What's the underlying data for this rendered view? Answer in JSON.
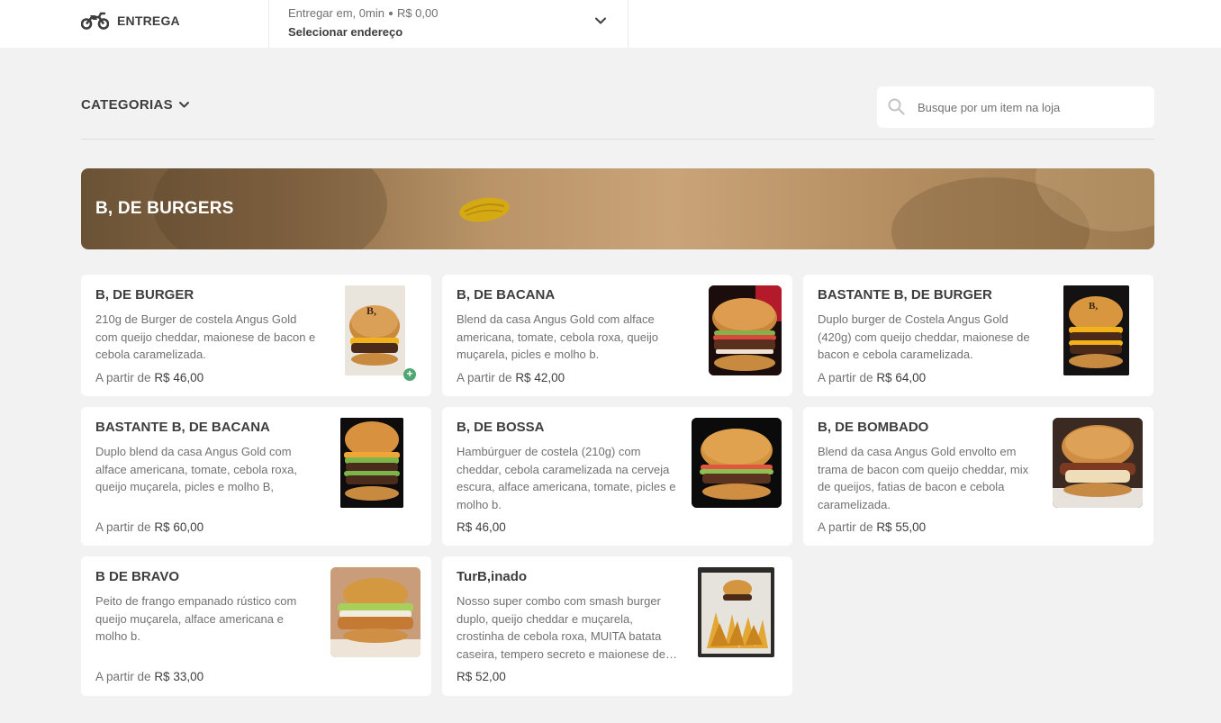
{
  "header": {
    "delivery_mode": "ENTREGA",
    "delivery_icon": "motorcycle-icon",
    "address_line1_time": "Entregar em, 0min",
    "address_line1_fee": "R$ 0,00",
    "address_line2": "Selecionar endereço"
  },
  "toolbar": {
    "categories_label": "CATEGORIAS",
    "search_placeholder": "Busque por um item na loja"
  },
  "section": {
    "title": "B, DE BURGERS"
  },
  "colors": {
    "accent": "#3e3e3e",
    "muted": "#717171",
    "add_badge": "#50a773",
    "page_bg": "#f2f2f2"
  },
  "items": [
    {
      "name": "B, DE BURGER",
      "description": "210g de Burger de costela Angus Gold com queijo cheddar, maionese de bacon e cebola caramelizada.",
      "price_prefix": "A partir de",
      "price": "R$ 46,00"
    },
    {
      "name": "B, DE BACANA",
      "description": "Blend da casa Angus Gold com alface americana, tomate, cebola roxa, queijo muçarela, picles e molho b.",
      "price_prefix": "A partir de",
      "price": "R$ 42,00"
    },
    {
      "name": "BASTANTE B, DE BURGER",
      "description": "Duplo burger de Costela Angus Gold (420g) com queijo cheddar, maionese de bacon e cebola caramelizada.",
      "price_prefix": "A partir de",
      "price": "R$ 64,00"
    },
    {
      "name": "BASTANTE B, DE BACANA",
      "description": "Duplo blend da casa Angus Gold com alface americana, tomate, cebola roxa, queijo muçarela, picles e molho B,",
      "price_prefix": "A partir de",
      "price": "R$ 60,00"
    },
    {
      "name": "B, DE BOSSA",
      "description": "Hambúrguer de costela (210g) com cheddar, cebola caramelizada na cerveja escura, alface americana, tomate, picles e molho b.",
      "price_prefix": "",
      "price": "R$ 46,00"
    },
    {
      "name": "B, DE BOMBADO",
      "description": "Blend da casa Angus Gold envolto em trama de bacon com queijo cheddar, mix de queijos, fatias de bacon e cebola caramelizada.",
      "price_prefix": "A partir de",
      "price": "R$ 55,00"
    },
    {
      "name": "B DE BRAVO",
      "description": "Peito de frango empanado rústico com queijo muçarela, alface americana e molho b.",
      "price_prefix": "A partir de",
      "price": "R$ 33,00"
    },
    {
      "name": "TurB,inado",
      "description": "Nosso super combo com smash burger duplo, queijo cheddar e muçarela, crostinha de cebola roxa, MUITA batata caseira, tempero secreto e maionese de bacon.",
      "price_prefix": "",
      "price": "R$ 52,00"
    }
  ]
}
